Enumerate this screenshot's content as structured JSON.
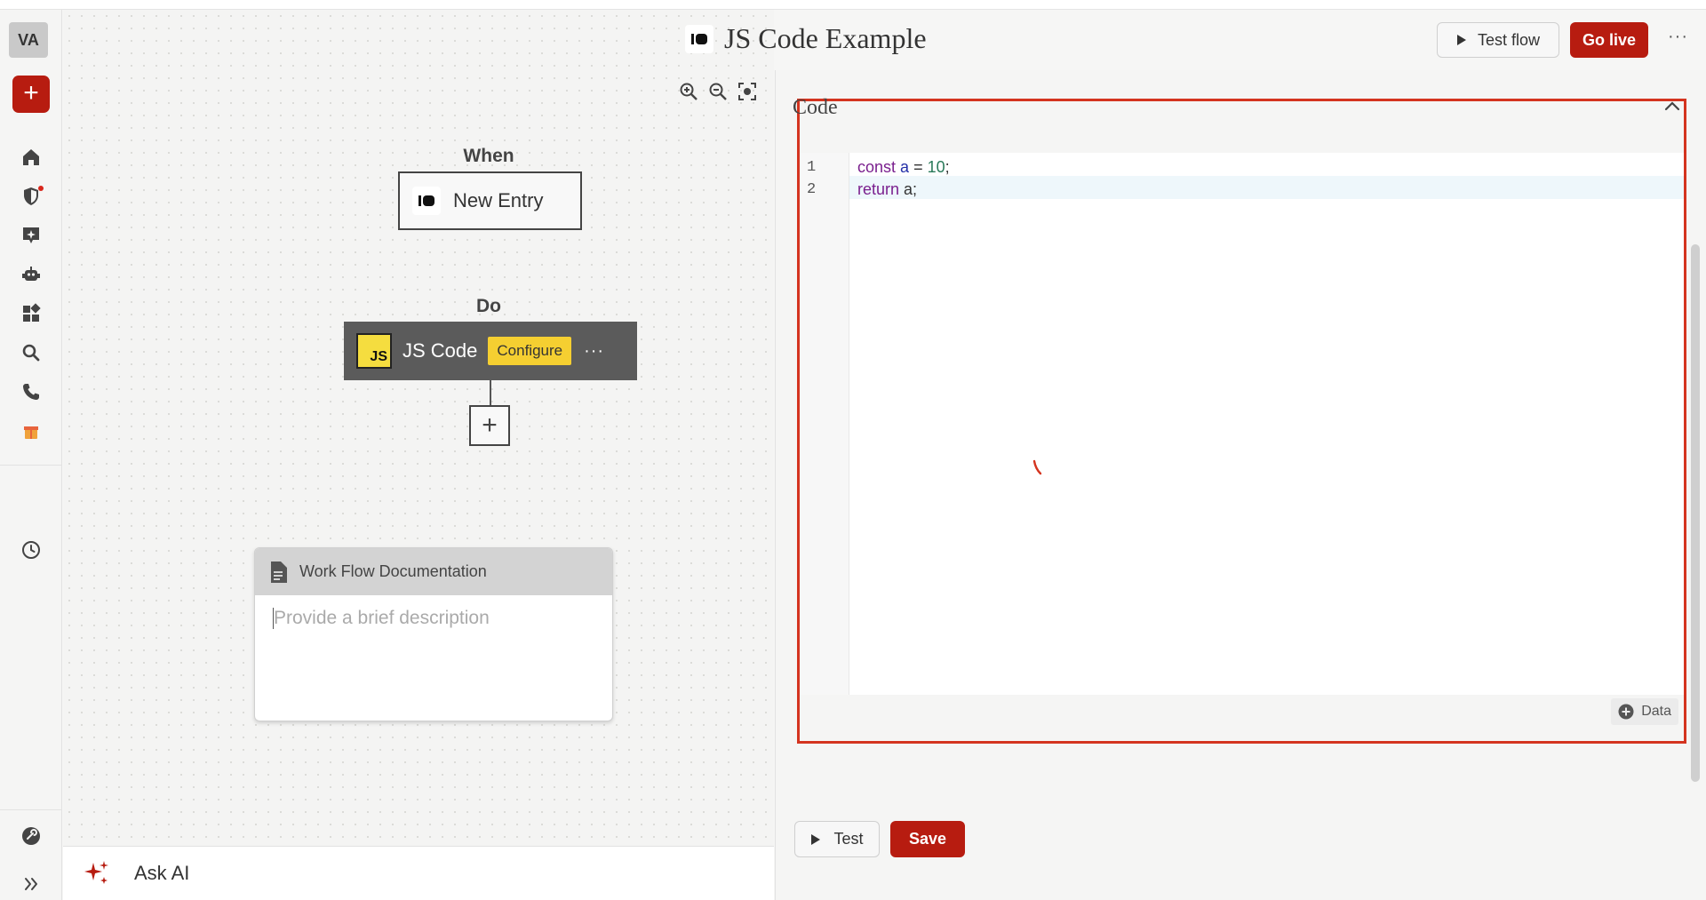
{
  "header": {
    "title": "JS Code Example",
    "test_flow_label": "Test flow",
    "go_live_label": "Go live",
    "more_label": "···"
  },
  "sidebar": {
    "avatar_initials": "VA",
    "add_label": "+",
    "items": [
      {
        "icon": "home-icon"
      },
      {
        "icon": "shield-icon",
        "has_notification": true
      },
      {
        "icon": "sparkle-chat-icon"
      },
      {
        "icon": "robot-icon"
      },
      {
        "icon": "dashboard-icon"
      },
      {
        "icon": "search-icon"
      },
      {
        "icon": "phone-icon"
      },
      {
        "icon": "gift-icon"
      },
      {
        "icon": "clock-icon"
      },
      {
        "icon": "help-icon"
      },
      {
        "icon": "expand-icon"
      }
    ]
  },
  "canvas": {
    "when_label": "When",
    "trigger_label": "New Entry",
    "do_label": "Do",
    "action_label": "JS Code",
    "action_icon_text": "JS",
    "configure_label": "Configure",
    "action_more_label": "···",
    "add_step_label": "+",
    "doc_title": "Work Flow Documentation",
    "doc_placeholder": "Provide a brief description"
  },
  "ask_ai": {
    "label": "Ask AI"
  },
  "code_panel": {
    "section_label": "Code",
    "lines": [
      {
        "number": "1",
        "tokens": [
          "const",
          " ",
          "a",
          " = ",
          "10",
          ";"
        ]
      },
      {
        "number": "2",
        "tokens": [
          "return",
          " a;"
        ]
      }
    ],
    "data_button_label": "Data",
    "test_label": "Test",
    "save_label": "Save"
  },
  "colors": {
    "accent": "#b71c10",
    "highlight_border": "#d4341f",
    "configure_badge": "#f5cf31",
    "action_node": "#5b5b5b"
  }
}
